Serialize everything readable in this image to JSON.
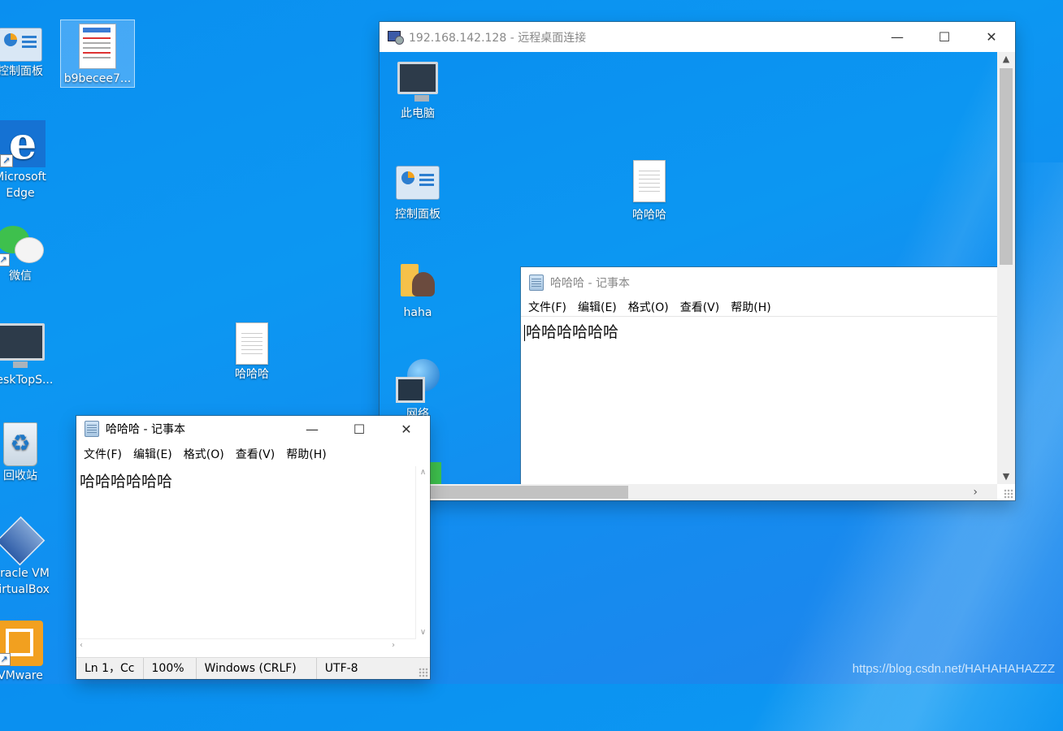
{
  "desktop": {
    "icons": [
      {
        "label": "控制面板",
        "icon": "control-panel-icon"
      },
      {
        "label": "b9becee7...",
        "icon": "document-thumbnail-icon"
      },
      {
        "label": "Microsoft Edge",
        "line1": "Microsoft",
        "line2": "Edge",
        "icon": "edge-icon"
      },
      {
        "label": "微信",
        "icon": "wechat-icon"
      },
      {
        "label": "DeskTopS...",
        "icon": "monitor-icon"
      },
      {
        "label": "哈哈哈",
        "icon": "text-file-icon"
      },
      {
        "label": "回收站",
        "icon": "recycle-bin-icon"
      },
      {
        "label": "Oracle VM VirtualBox",
        "line1": "Oracle VM",
        "line2": "VirtualBox",
        "icon": "virtualbox-icon"
      },
      {
        "label": "VMware",
        "icon": "vmware-icon"
      }
    ],
    "watermark": "https://blog.csdn.net/HAHAHAHAZZZ"
  },
  "rdp_window": {
    "title": "192.168.142.128 - 远程桌面连接",
    "icons": [
      {
        "label": "此电脑",
        "icon": "this-pc-icon"
      },
      {
        "label": "控制面板",
        "icon": "control-panel-icon"
      },
      {
        "label": "哈哈哈",
        "icon": "text-file-icon"
      },
      {
        "label": "haha",
        "icon": "user-folder-icon"
      },
      {
        "label": "网络",
        "icon": "network-icon"
      }
    ],
    "notepad": {
      "title": "哈哈哈 - 记事本",
      "menu": [
        "文件(F)",
        "编辑(E)",
        "格式(O)",
        "查看(V)",
        "帮助(H)"
      ],
      "content": "哈哈哈哈哈哈"
    }
  },
  "notepad": {
    "title": "哈哈哈 - 记事本",
    "menu": [
      "文件(F)",
      "编辑(E)",
      "格式(O)",
      "查看(V)",
      "帮助(H)"
    ],
    "content": "哈哈哈哈哈哈",
    "status": {
      "position": "Ln 1，Cc",
      "zoom": "100%",
      "line_ending": "Windows (CRLF)",
      "encoding": "UTF-8"
    }
  },
  "window_controls": {
    "minimize": "—",
    "maximize": "☐",
    "close": "✕"
  }
}
